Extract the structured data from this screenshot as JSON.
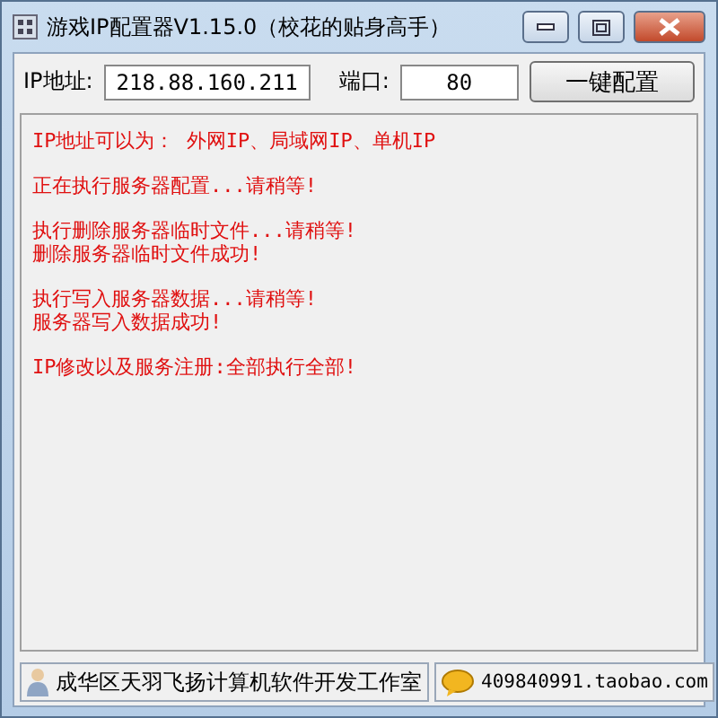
{
  "window": {
    "title": "游戏IP配置器V1.15.0（校花的贴身高手）"
  },
  "form": {
    "ip_label": "IP地址:",
    "ip_value": "218.88.160.211",
    "port_label": "端口:",
    "port_value": "80",
    "button": "一键配置"
  },
  "log": [
    [
      "IP地址可以为：  外网IP、局域网IP、单机IP"
    ],
    [
      "正在执行服务器配置...请稍等!"
    ],
    [
      "执行删除服务器临时文件...请稍等!",
      "删除服务器临时文件成功!"
    ],
    [
      "执行写入服务器数据...请稍等!",
      "服务器写入数据成功!"
    ],
    [
      "IP修改以及服务注册:全部执行全部!"
    ]
  ],
  "status_bar": {
    "studio": "成华区天羽飞扬计算机软件开发工作室",
    "link": "409840991.taobao.com"
  }
}
